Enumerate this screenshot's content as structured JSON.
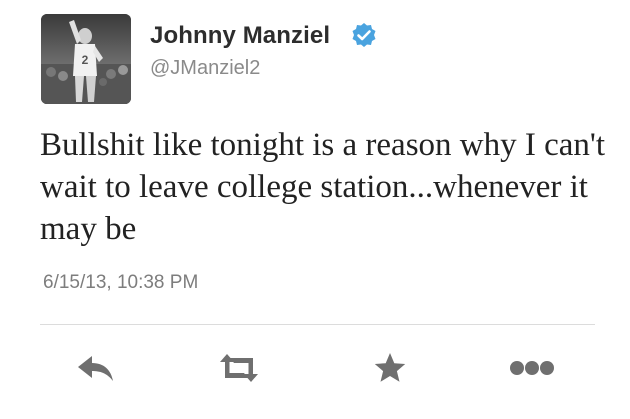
{
  "user": {
    "display_name": "Johnny Manziel",
    "handle": "@JManziel2",
    "verified": true,
    "avatar_icon": "profile-photo"
  },
  "tweet": {
    "text": "Bullshit like tonight is a reason why I can't wait to leave college station...whenever it may be",
    "timestamp": "6/15/13, 10:38 PM"
  },
  "actions": [
    {
      "name": "reply",
      "icon": "reply-arrow-icon"
    },
    {
      "name": "retweet",
      "icon": "retweet-icon"
    },
    {
      "name": "favorite",
      "icon": "star-icon"
    },
    {
      "name": "more",
      "icon": "more-dots-icon"
    }
  ],
  "colors": {
    "verified_badge": "#4aa3df",
    "action_icon": "#6f6f6f",
    "divider": "#dcdcdc",
    "handle": "#8a8a8a"
  }
}
